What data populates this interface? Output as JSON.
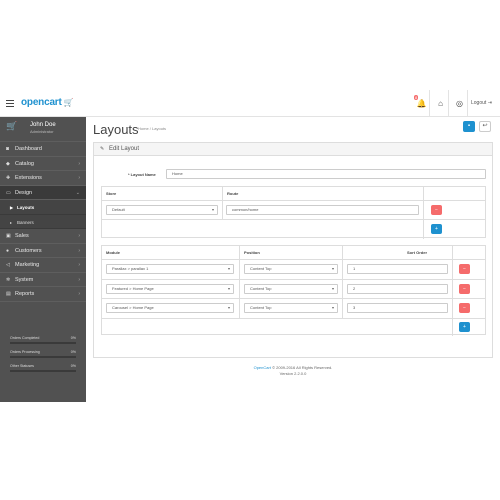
{
  "header": {
    "logo_text": "opencart",
    "notification_count": "8",
    "logout_label": "Logout"
  },
  "sidebar": {
    "user_name": "John Doe",
    "user_role": "Administrator",
    "items": [
      {
        "label": "Dashboard",
        "icon": "dashboard-icon"
      },
      {
        "label": "Catalog",
        "icon": "tag-icon"
      },
      {
        "label": "Extensions",
        "icon": "puzzle-icon"
      },
      {
        "label": "Design",
        "icon": "monitor-icon"
      },
      {
        "label": "Sales",
        "icon": "cart-icon"
      },
      {
        "label": "Customers",
        "icon": "user-icon"
      },
      {
        "label": "Marketing",
        "icon": "share-icon"
      },
      {
        "label": "System",
        "icon": "cog-icon"
      },
      {
        "label": "Reports",
        "icon": "chart-icon"
      }
    ],
    "design_sub": [
      {
        "label": "Layouts"
      },
      {
        "label": "Banners"
      }
    ],
    "stats": [
      {
        "label": "Orders Completed",
        "percent": "0%"
      },
      {
        "label": "Orders Processing",
        "percent": "0%"
      },
      {
        "label": "Other Statuses",
        "percent": "0%"
      }
    ]
  },
  "page": {
    "title": "Layouts",
    "breadcrumb": [
      "Home",
      "Layouts"
    ],
    "panel_title": "Edit Layout",
    "layout_name_label": "* Layout Name",
    "layout_name_value": "Home"
  },
  "route_table": {
    "headers": [
      "Store",
      "Route"
    ],
    "rows": [
      {
        "store": "Default",
        "route": "common/home"
      }
    ]
  },
  "module_table": {
    "headers": [
      "Module",
      "Position",
      "Sort Order"
    ],
    "rows": [
      {
        "module": "Parallax > parallax 1",
        "position": "Content Top",
        "sort": "1"
      },
      {
        "module": "Featured > Home Page",
        "position": "Content Top",
        "sort": "2"
      },
      {
        "module": "Carousel > Home Page",
        "position": "Content Top",
        "sort": "3"
      }
    ]
  },
  "footer": {
    "brand": "OpenCart",
    "copyright": "© 2009-2016 All Rights Reserved.",
    "version": "Version 2.2.0.0"
  },
  "colors": {
    "accent": "#1e91cf",
    "danger": "#f56b6b",
    "sidebar_bg": "#515151"
  }
}
